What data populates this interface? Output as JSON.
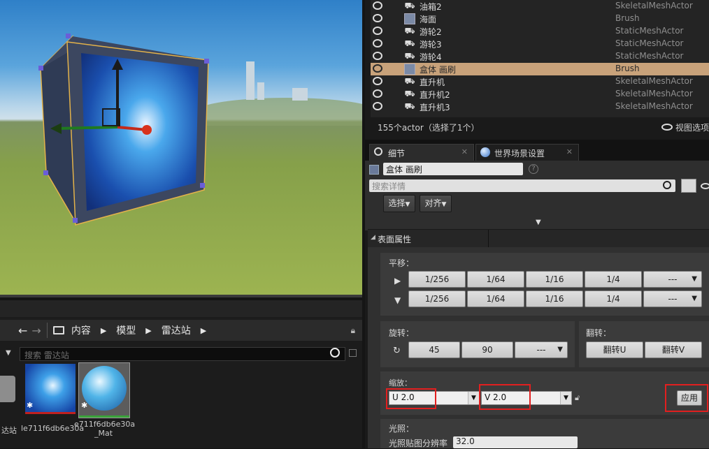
{
  "outliner": {
    "rows": [
      {
        "name": "油箱2",
        "type": "SkeletalMeshActor",
        "icon": "skeletal-icon"
      },
      {
        "name": "海面",
        "type": "Brush",
        "icon": "brush-icon"
      },
      {
        "name": "游轮2",
        "type": "StaticMeshActor",
        "icon": "static-mesh-icon"
      },
      {
        "name": "游轮3",
        "type": "StaticMeshActor",
        "icon": "static-mesh-icon"
      },
      {
        "name": "游轮4",
        "type": "StaticMeshActor",
        "icon": "static-mesh-icon"
      },
      {
        "name": "盒体 画刷",
        "type": "Brush",
        "icon": "brush-icon",
        "selected": true
      },
      {
        "name": "直升机",
        "type": "SkeletalMeshActor",
        "icon": "skeletal-icon"
      },
      {
        "name": "直升机2",
        "type": "SkeletalMeshActor",
        "icon": "skeletal-icon"
      },
      {
        "name": "直升机3",
        "type": "SkeletalMeshActor",
        "icon": "skeletal-icon"
      }
    ],
    "status": "155个actor（选择了1个）",
    "view_options": "视图选项"
  },
  "tabs": {
    "details": "细节",
    "world_settings": "世界场景设置"
  },
  "details": {
    "actor_name": "盒体 画刷",
    "search_placeholder": "搜索详情",
    "select_label": "选择",
    "align_label": "对齐",
    "section_title": "表面属性",
    "pan_label": "平移：",
    "pan_row1": [
      "1/256",
      "1/64",
      "1/16",
      "1/4",
      "---"
    ],
    "pan_row2": [
      "1/256",
      "1/64",
      "1/16",
      "1/4",
      "---"
    ],
    "rotate_label": "旋转：",
    "rotate_buttons": [
      "45",
      "90",
      "---"
    ],
    "flip_label": "翻转：",
    "flip_u": "翻转U",
    "flip_v": "翻转V",
    "scale_label": "缩放：",
    "scale_u": "U  2.0",
    "scale_v": "V  2.0",
    "apply_label": "应用",
    "lighting_label": "光照：",
    "lightmap_res_label": "光照贴图分辨率",
    "lightmap_res_value": "32.0"
  },
  "content_browser": {
    "path": [
      "内容",
      "模型",
      "雷达站"
    ],
    "search_placeholder": "搜索 雷达站",
    "assets": [
      {
        "label": "le711f6db6e30a"
      },
      {
        "label": "e711f6db6e30a\n_Mat"
      }
    ],
    "left_cut_label": "达站"
  },
  "colors": {
    "selected_row": "#c8a27a",
    "highlight_box": "#e21f1f",
    "texture_underline": "#c02020",
    "material_underline": "#3aa33a"
  }
}
